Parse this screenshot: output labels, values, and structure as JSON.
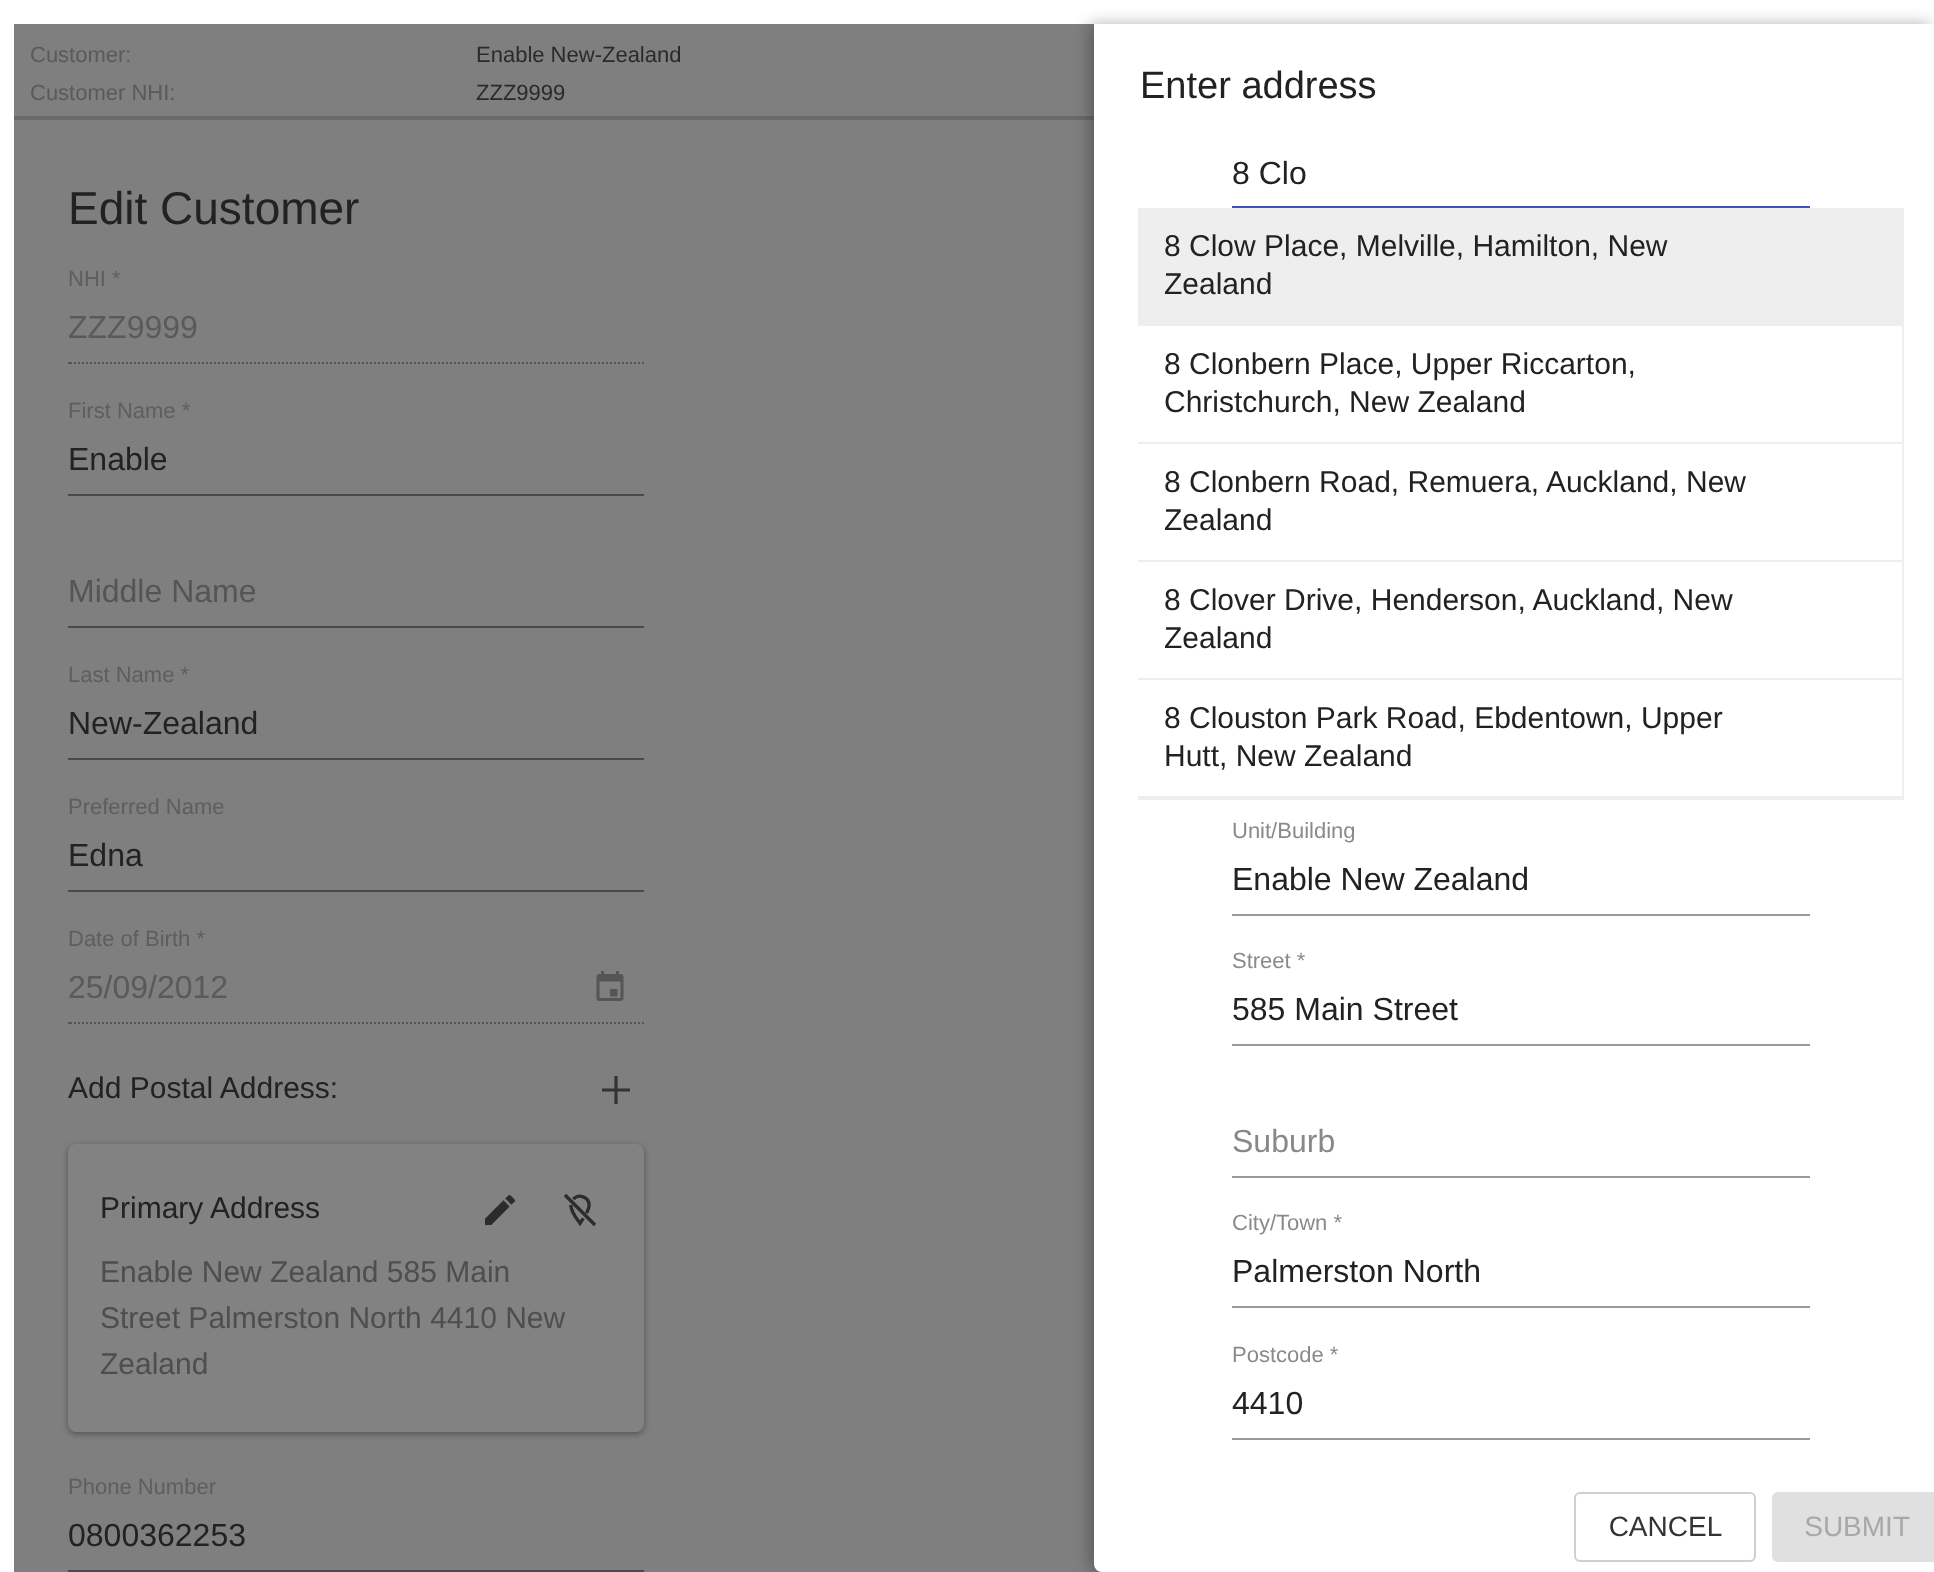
{
  "header": {
    "rows": [
      {
        "label": "Customer:",
        "value": "Enable New-Zealand"
      },
      {
        "label": "Customer NHI:",
        "value": "ZZZ9999"
      }
    ]
  },
  "form": {
    "title": "Edit Customer",
    "fields": [
      {
        "kind": "text",
        "label": "NHI *",
        "value": "ZZZ9999",
        "disabled": true
      },
      {
        "kind": "text",
        "label": "First Name *",
        "value": "Enable",
        "disabled": false
      },
      {
        "kind": "text",
        "placeholder": "Middle Name",
        "disabled": false
      },
      {
        "kind": "text",
        "label": "Last Name *",
        "value": "New-Zealand",
        "disabled": false
      },
      {
        "kind": "text",
        "label": "Preferred Name",
        "value": "Edna",
        "disabled": false
      },
      {
        "kind": "date",
        "label": "Date of Birth *",
        "value": "25/09/2012",
        "disabled": true
      }
    ],
    "postal": {
      "label": "Add Postal Address:",
      "card": {
        "title": "Primary Address",
        "text": "Enable New Zealand 585 Main Street Palmerston North 4410 New Zealand"
      }
    },
    "phone": {
      "label": "Phone Number",
      "value": "0800362253"
    }
  },
  "dialog": {
    "title": "Enter address",
    "search": {
      "value": "8 Clo"
    },
    "suggestions": [
      {
        "text": "8 Clow Place, Melville, Hamilton, New Zealand",
        "selected": true
      },
      {
        "text": "8 Clonbern Place, Upper Riccarton, Christchurch, New Zealand",
        "selected": false
      },
      {
        "text": "8 Clonbern Road, Remuera, Auckland, New Zealand",
        "selected": false
      },
      {
        "text": "8 Clover Drive, Henderson, Auckland, New Zealand",
        "selected": false
      },
      {
        "text": "8 Clouston Park Road, Ebdentown, Upper Hutt, New Zealand",
        "selected": false
      }
    ],
    "fields": [
      {
        "label": "Unit/Building",
        "value": "Enable New Zealand"
      },
      {
        "label": "Street *",
        "value": "585 Main Street"
      },
      {
        "placeholder": "Suburb"
      },
      {
        "label": "City/Town *",
        "value": "Palmerston North"
      },
      {
        "label": "Postcode *",
        "value": "4410"
      }
    ],
    "buttons": [
      {
        "label": "CANCEL",
        "disabled": false
      },
      {
        "label": "SUBMIT",
        "disabled": true
      }
    ]
  }
}
